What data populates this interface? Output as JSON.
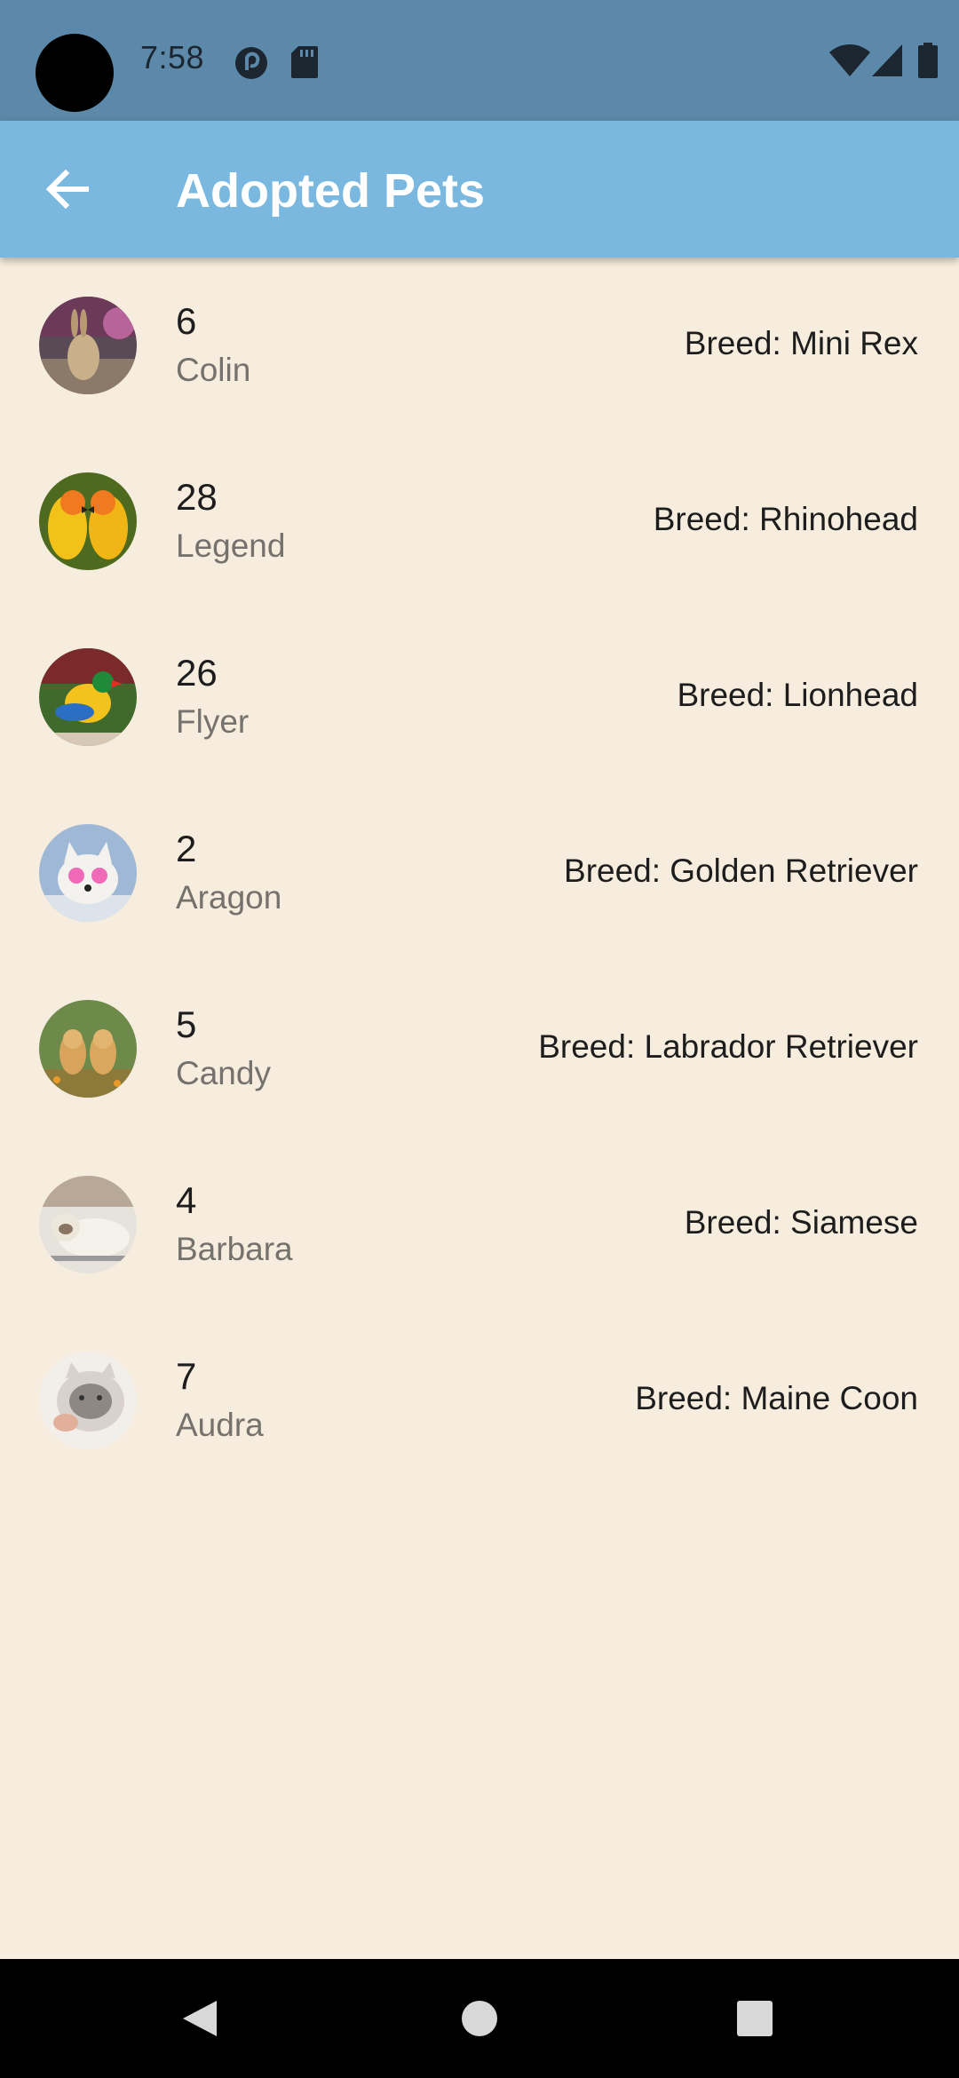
{
  "status_bar": {
    "time": "7:58",
    "icons_left": [
      "pocket-casts-icon",
      "sd-card-icon"
    ],
    "icons_right": [
      "wifi-icon",
      "cell-signal-icon",
      "battery-icon"
    ]
  },
  "app_bar": {
    "title": "Adopted Pets",
    "back_icon": "arrow-back-icon"
  },
  "pets": [
    {
      "id": "6",
      "name": "Colin",
      "breed": "Breed: Mini Rex",
      "avatar": "rabbit"
    },
    {
      "id": "28",
      "name": "Legend",
      "breed": "Breed: Rhinohead",
      "avatar": "parrots"
    },
    {
      "id": "26",
      "name": "Flyer",
      "breed": "Breed: Lionhead",
      "avatar": "finch"
    },
    {
      "id": "2",
      "name": "Aragon",
      "breed": "Breed: Golden Retriever",
      "avatar": "white-dog"
    },
    {
      "id": "5",
      "name": "Candy",
      "breed": "Breed: Labrador Retriever",
      "avatar": "puppies"
    },
    {
      "id": "4",
      "name": "Barbara",
      "breed": "Breed: Siamese",
      "avatar": "white-cat"
    },
    {
      "id": "7",
      "name": "Audra",
      "breed": "Breed: Maine Coon",
      "avatar": "fluffy-cat"
    }
  ],
  "nav_bar": {
    "buttons": [
      "back-triangle-icon",
      "home-circle-icon",
      "recents-square-icon"
    ]
  },
  "colors": {
    "status_bar": "#5C89A9",
    "app_bar": "#7AB8DF",
    "background": "#F7EDDE",
    "nav_bar": "#000000"
  }
}
